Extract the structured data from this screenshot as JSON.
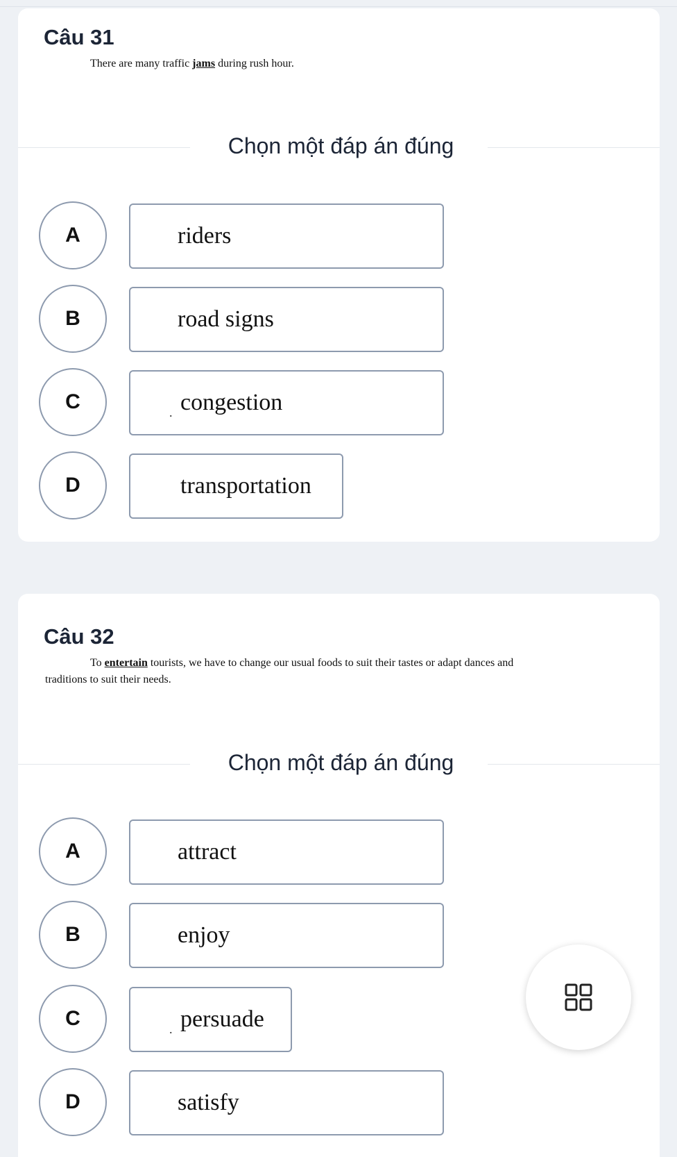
{
  "questions": [
    {
      "title": "Câu 31",
      "text_before": "There are many traffic ",
      "underlined": "jams",
      "text_after": " during rush hour.",
      "instruction": "Chọn một đáp án đúng",
      "options": [
        {
          "letter": "A",
          "text": "riders"
        },
        {
          "letter": "B",
          "text": "road signs"
        },
        {
          "letter": "C",
          "text": "congestion"
        },
        {
          "letter": "D",
          "text": "transportation"
        }
      ]
    },
    {
      "title": "Câu 32",
      "text_before": "To ",
      "underlined": "entertain",
      "text_after": " tourists, we have to change our usual foods to suit their tastes or adapt dances and",
      "text_line2": "traditions to suit their needs.",
      "instruction": "Chọn một đáp án đúng",
      "options": [
        {
          "letter": "A",
          "text": "attract"
        },
        {
          "letter": "B",
          "text": "enjoy"
        },
        {
          "letter": "C",
          "text": "persuade"
        },
        {
          "letter": "D",
          "text": "satisfy"
        }
      ]
    }
  ],
  "fab": {
    "icon": "grid-icon"
  },
  "colors": {
    "border": "#8d9aae",
    "background": "#eef1f5",
    "card": "#ffffff"
  }
}
